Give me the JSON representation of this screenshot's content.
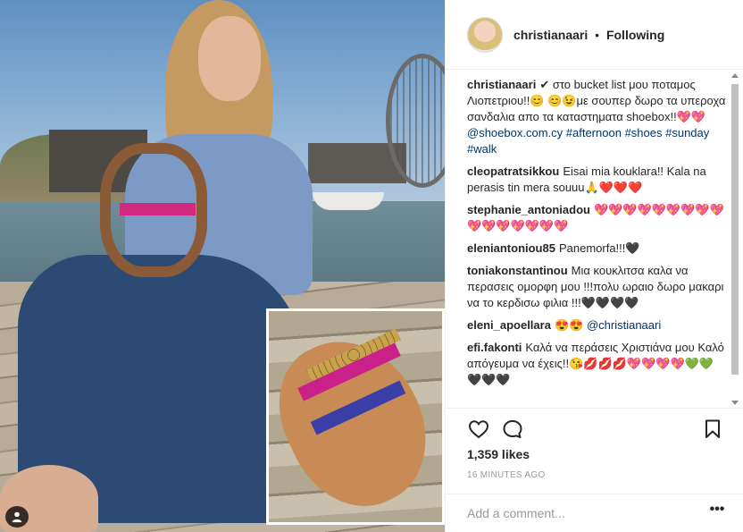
{
  "post": {
    "author": "christianaari",
    "follow_status": "Following",
    "separator": "•"
  },
  "comments": [
    {
      "author": "christianaari",
      "parts": [
        {
          "t": "text",
          "v": "✔ στο bucket list μου ποταμος Λιοπετριου!!😊 😊😉με σουπερ δωρο τα υπεροχα σανδαλια απο τα καταστηματα shoebox!!💖💖 "
        },
        {
          "t": "link",
          "v": "@shoebox.com.cy"
        },
        {
          "t": "text",
          "v": " "
        },
        {
          "t": "link",
          "v": "#afternoon"
        },
        {
          "t": "text",
          "v": " "
        },
        {
          "t": "link",
          "v": "#shoes"
        },
        {
          "t": "text",
          "v": " "
        },
        {
          "t": "link",
          "v": "#sunday"
        },
        {
          "t": "text",
          "v": " "
        },
        {
          "t": "link",
          "v": "#walk"
        }
      ]
    },
    {
      "author": "cleopatratsikkou",
      "parts": [
        {
          "t": "text",
          "v": "Eisai mia kouklara!! Kala na perasis tin mera souuu🙏❤️❤️❤️"
        }
      ]
    },
    {
      "author": "stephanie_antoniadou",
      "parts": [
        {
          "t": "text",
          "v": "💖💖💖💖💖💖💖💖💖💖💖💖💖💖💖💖"
        }
      ]
    },
    {
      "author": "eleniantoniou85",
      "parts": [
        {
          "t": "text",
          "v": "Panemorfa!!!🖤"
        }
      ]
    },
    {
      "author": "toniakonstantinou",
      "parts": [
        {
          "t": "text",
          "v": "Μια κουκλιτσα καλα να περασεις ομορφη μου !!!πολυ ωραιο δωρο μακαρι να το κερδισω φιλια !!!🖤🖤🖤🖤"
        }
      ]
    },
    {
      "author": "eleni_apoellara",
      "parts": [
        {
          "t": "text",
          "v": "😍😍 "
        },
        {
          "t": "link",
          "v": "@christianaari"
        }
      ]
    },
    {
      "author": "efi.fakonti",
      "parts": [
        {
          "t": "text",
          "v": "Καλά να περάσεις Χριστιάνα μου Καλό απόγευμα να έχεις!!😘💋💋💋💖💖💖💖💚💚🖤🖤🖤"
        }
      ]
    }
  ],
  "actions": {
    "like_icon": "heart-outline-icon",
    "comment_icon": "speech-bubble-icon",
    "save_icon": "bookmark-icon"
  },
  "likes": "1,359 likes",
  "timestamp": "16 MINUTES AGO",
  "comment_box": {
    "placeholder": "Add a comment...",
    "more_label": "•••"
  },
  "colors": {
    "text": "#262626",
    "link": "#003569",
    "muted": "#999999",
    "border": "#efefef"
  }
}
